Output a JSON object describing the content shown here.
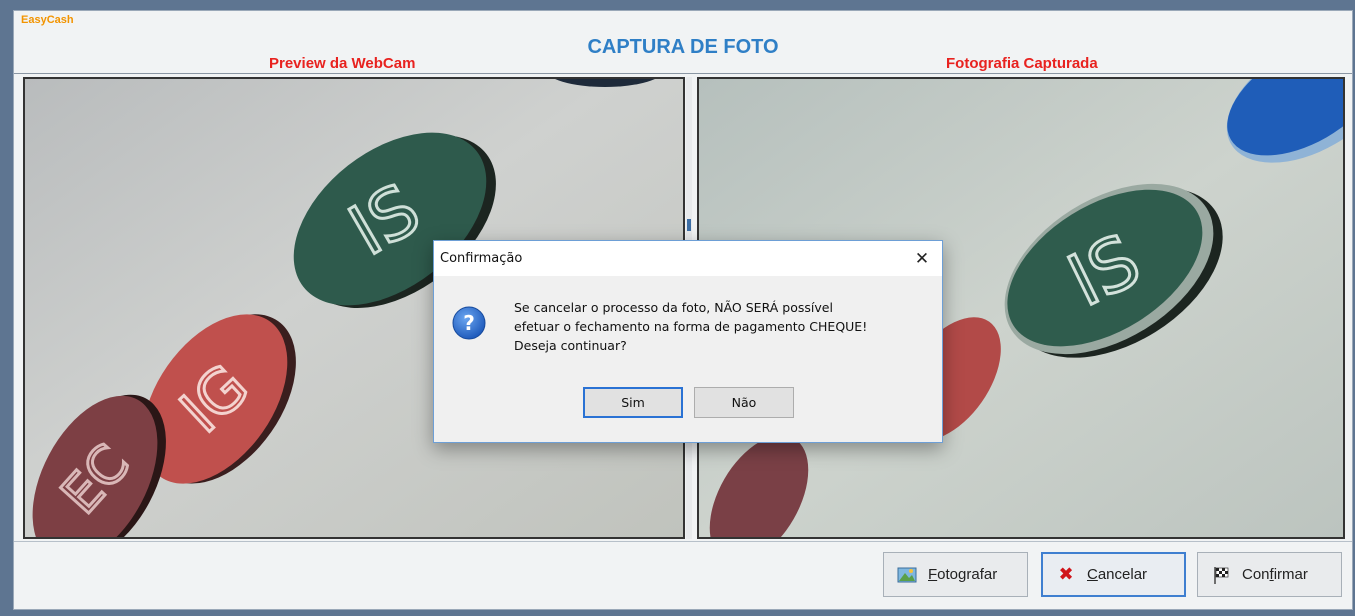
{
  "app": {
    "brand": "EasyCash",
    "title": "CAPTURA DE FOTO",
    "accent_color": "#2f7fc6",
    "label_color": "#e8221f",
    "brand_color": "#f29400"
  },
  "panes": {
    "preview_label": "Preview da WebCam",
    "captured_label": "Fotografia Capturada",
    "signs": [
      "IS",
      "IG",
      "EC"
    ]
  },
  "actions": {
    "photograph": {
      "label_underlined": "F",
      "label_rest": "otografar",
      "icon": "camera-photo-icon"
    },
    "cancel": {
      "label_underlined": "C",
      "label_rest": "ancelar",
      "icon": "red-x-icon"
    },
    "confirm": {
      "label_prefix": "Con",
      "label_underlined": "f",
      "label_rest": "irmar",
      "icon": "checkered-flag-icon"
    }
  },
  "dialog": {
    "title": "Confirmação",
    "close_glyph": "✕",
    "icon": "question-icon",
    "message_line1": "Se cancelar o processo da foto, NÃO SERÁ possível",
    "message_line2": "efetuar o fechamento na forma de pagamento CHEQUE!",
    "message_line3": "Deseja continuar?",
    "yes_label": "Sim",
    "no_label": "Não"
  }
}
